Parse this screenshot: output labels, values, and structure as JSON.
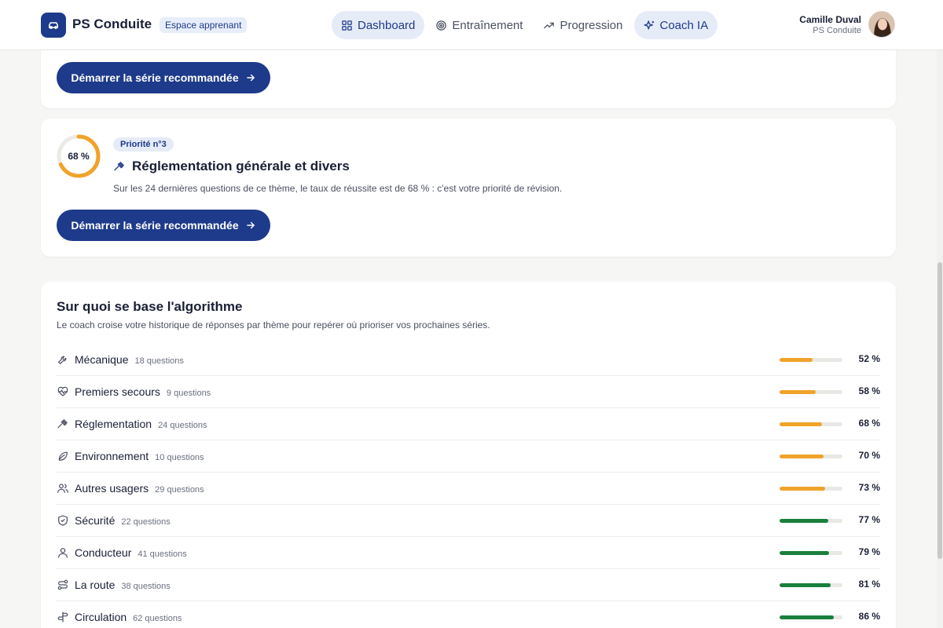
{
  "header": {
    "brand": "PS Conduite",
    "badge": "Espace apprenant",
    "nav": [
      {
        "label": "Dashboard",
        "icon": "grid-icon",
        "active": true
      },
      {
        "label": "Entraînement",
        "icon": "target-icon",
        "active": false
      },
      {
        "label": "Progression",
        "icon": "trend-icon",
        "active": false
      },
      {
        "label": "Coach IA",
        "icon": "sparkles-icon",
        "active": true
      }
    ],
    "user": {
      "name": "Camille Duval",
      "org": "PS Conduite"
    }
  },
  "top_card": {
    "cta": "Démarrer la série recommandée"
  },
  "priority_card": {
    "score": "68 %",
    "score_value": 68,
    "badge": "Priorité n°3",
    "title": "Réglementation générale et divers",
    "description": "Sur les 24 dernières questions de ce thème, le taux de réussite est de 68 % : c'est votre priorité de révision.",
    "cta": "Démarrer la série recommandée"
  },
  "algo": {
    "title": "Sur quoi se base l'algorithme",
    "subtitle": "Le coach croise votre historique de réponses par thème pour repérer où prioriser vos prochaines séries.",
    "rows": [
      {
        "name": "Mécanique",
        "count": "18 questions",
        "pct": "52 %",
        "value": 52,
        "icon": "wrench-icon",
        "color": "#f0a32a"
      },
      {
        "name": "Premiers secours",
        "count": "9 questions",
        "pct": "58 %",
        "value": 58,
        "icon": "heart-pulse-icon",
        "color": "#f0a32a"
      },
      {
        "name": "Réglementation",
        "count": "24 questions",
        "pct": "68 %",
        "value": 68,
        "icon": "gavel-icon",
        "color": "#f0a32a"
      },
      {
        "name": "Environnement",
        "count": "10 questions",
        "pct": "70 %",
        "value": 70,
        "icon": "leaf-icon",
        "color": "#f0a32a"
      },
      {
        "name": "Autres usagers",
        "count": "29 questions",
        "pct": "73 %",
        "value": 73,
        "icon": "users-icon",
        "color": "#f0a32a"
      },
      {
        "name": "Sécurité",
        "count": "22 questions",
        "pct": "77 %",
        "value": 77,
        "icon": "shield-icon",
        "color": "#1a7f3c"
      },
      {
        "name": "Conducteur",
        "count": "41 questions",
        "pct": "79 %",
        "value": 79,
        "icon": "user-icon",
        "color": "#1a7f3c"
      },
      {
        "name": "La route",
        "count": "38 questions",
        "pct": "81 %",
        "value": 81,
        "icon": "route-icon",
        "color": "#1a7f3c"
      },
      {
        "name": "Circulation",
        "count": "62 questions",
        "pct": "86 %",
        "value": 86,
        "icon": "signpost-icon",
        "color": "#1a7f3c"
      }
    ]
  }
}
